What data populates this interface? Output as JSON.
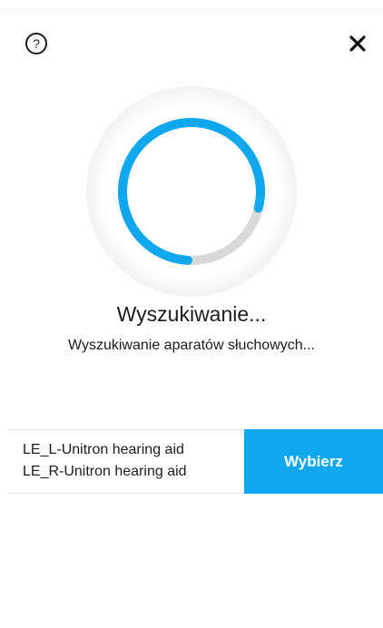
{
  "header": {
    "help_icon_glyph": "?",
    "help_icon": "question-circle-icon",
    "close_icon": "close-x-icon"
  },
  "spinner": {
    "progress_fraction": 0.78,
    "accent_color": "#0fa8ee",
    "track_color": "#d9d9d9"
  },
  "status": {
    "title": "Wyszukiwanie...",
    "subtitle": "Wyszukiwanie aparatów słuchowych..."
  },
  "devices": {
    "items": [
      "LE_L-Unitron hearing aid",
      "LE_R-Unitron hearing aid"
    ],
    "select_label": "Wybierz",
    "select_color": "#0fa8ee"
  }
}
